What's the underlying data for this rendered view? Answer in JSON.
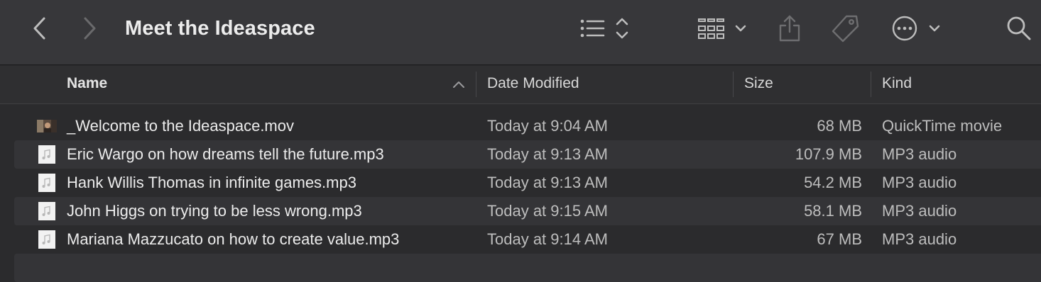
{
  "window": {
    "title": "Meet the Ideaspace"
  },
  "toolbar": {
    "back_icon": "chevron-left-icon",
    "forward_icon": "chevron-right-icon",
    "list_view_icon": "list-icon",
    "grid_view_icon": "grid-icon",
    "share_icon": "share-icon",
    "tag_icon": "tag-icon",
    "more_icon": "ellipsis-circle-icon",
    "search_icon": "search-icon"
  },
  "columns": {
    "name": "Name",
    "date": "Date Modified",
    "size": "Size",
    "kind": "Kind"
  },
  "files": [
    {
      "name": "_Welcome to the Ideaspace.mov",
      "date": "Today at 9:04 AM",
      "size": "68 MB",
      "kind": "QuickTime movie",
      "icon": "video-thumbnail-icon"
    },
    {
      "name": "Eric Wargo on how dreams tell the future.mp3",
      "date": "Today at 9:13 AM",
      "size": "107.9 MB",
      "kind": "MP3 audio",
      "icon": "audio-file-icon"
    },
    {
      "name": "Hank Willis Thomas in infinite games.mp3",
      "date": "Today at 9:13 AM",
      "size": "54.2 MB",
      "kind": "MP3 audio",
      "icon": "audio-file-icon"
    },
    {
      "name": "John Higgs on trying to be less wrong.mp3",
      "date": "Today at 9:15 AM",
      "size": "58.1 MB",
      "kind": "MP3 audio",
      "icon": "audio-file-icon"
    },
    {
      "name": "Mariana Mazzucato on how to create value.mp3",
      "date": "Today at 9:14 AM",
      "size": "67 MB",
      "kind": "MP3 audio",
      "icon": "audio-file-icon"
    }
  ],
  "colors": {
    "background": "#2b2b2d",
    "toolbar": "#37373a",
    "alt_row": "#343437",
    "text": "#ececec",
    "secondary_text": "#bdbdbd"
  }
}
